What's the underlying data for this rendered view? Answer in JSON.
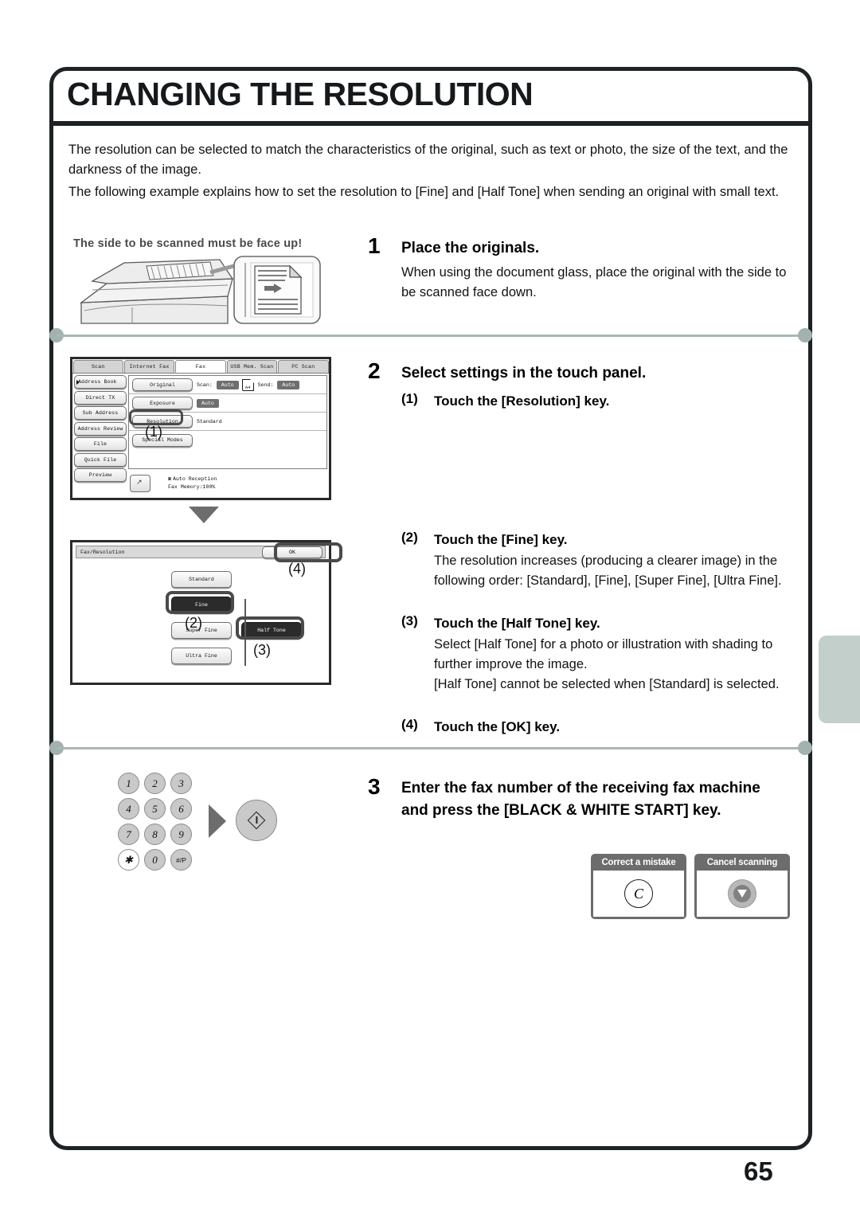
{
  "page_title": "CHANGING THE RESOLUTION",
  "page_number": "65",
  "intro": {
    "paragraph_1": "The resolution can be selected to match the characteristics of the original, such as text or photo, the size of the text, and the darkness of the image.",
    "paragraph_2": "The following example explains how to set the resolution to [Fine] and [Half Tone] when sending an original with small text."
  },
  "steps": [
    {
      "number": "1",
      "heading": "Place the originals.",
      "body": "When using the document glass, place the original with the side to be scanned face down.",
      "illustration_note": "The side to be scanned must be face up!"
    },
    {
      "number": "2",
      "heading": "Select settings in the touch panel.",
      "substeps": [
        {
          "marker": "(1)",
          "heading": "Touch the [Resolution] key.",
          "body": ""
        },
        {
          "marker": "(2)",
          "heading": "Touch the [Fine] key.",
          "body": "The resolution increases (producing a clearer image) in the following order: [Standard], [Fine], [Super Fine], [Ultra Fine]."
        },
        {
          "marker": "(3)",
          "heading": "Touch the [Half Tone] key.",
          "body": "Select [Half Tone] for a photo or illustration with shading to further improve the image.\n[Half Tone] cannot be selected when [Standard] is selected."
        },
        {
          "marker": "(4)",
          "heading": "Touch the [OK] key.",
          "body": ""
        }
      ]
    },
    {
      "number": "3",
      "heading": "Enter the fax number of the receiving fax machine and press the [BLACK & WHITE START] key."
    }
  ],
  "touch_panel_1": {
    "tabs": [
      {
        "label": "Scan",
        "active": false
      },
      {
        "label": "Internet Fax",
        "active": false
      },
      {
        "label": "Fax",
        "active": true
      },
      {
        "label": "USB Mem. Scan",
        "active": false
      },
      {
        "label": "PC Scan",
        "active": false
      }
    ],
    "side_keys": [
      "Address Book",
      "Direct TX",
      "Sub Address",
      "Address Review",
      "File",
      "Quick File",
      "Preview"
    ],
    "rows": [
      {
        "key": "Original",
        "label_scan": "Scan:",
        "value_scan": "Auto",
        "paper": "A4",
        "label_send": "Send:",
        "value_send": "Auto"
      },
      {
        "key": "Exposure",
        "value": "Auto"
      },
      {
        "key": "Resolution",
        "value": "Standard"
      },
      {
        "key": "Special Modes",
        "value": ""
      }
    ],
    "status_line_1": "Auto Reception",
    "status_line_2": "Fax Memory:100%",
    "callout": "(1)"
  },
  "touch_panel_2": {
    "title": "Fax/Resolution",
    "ok_label": "OK",
    "resolution_keys": [
      {
        "label": "Standard",
        "selected": false
      },
      {
        "label": "Fine",
        "selected": true
      },
      {
        "label": "Super Fine",
        "selected": false
      },
      {
        "label": "Ultra Fine",
        "selected": false
      }
    ],
    "half_tone_key": {
      "label": "Half Tone",
      "selected": true
    },
    "callouts": {
      "fine": "(2)",
      "half_tone": "(3)",
      "ok": "(4)"
    }
  },
  "keypad": {
    "keys": [
      "1",
      "2",
      "3",
      "4",
      "5",
      "6",
      "7",
      "8",
      "9",
      "✱",
      "0",
      "#/P"
    ],
    "start_key_name": "start-key"
  },
  "bottom_boxes": [
    {
      "caption": "Correct a mistake",
      "glyph": "C"
    },
    {
      "caption": "Cancel scanning",
      "glyph": "stop"
    }
  ],
  "colors": {
    "frame": "#1d2224",
    "divider": "#a8b8b4",
    "side_tab": "#c2cfcb",
    "callout_box": "#6c6c6c",
    "selected_key": "#2b2b2b"
  }
}
